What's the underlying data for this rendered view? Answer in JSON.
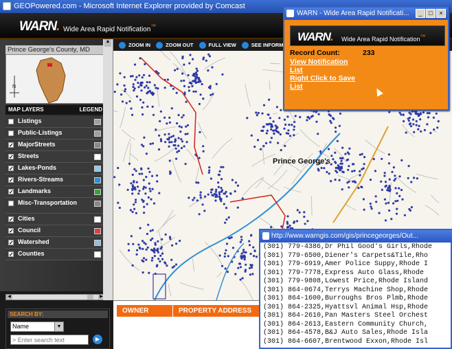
{
  "main_window": {
    "title": "GEOPowered.com - Microsoft Internet Explorer provided by Comcast"
  },
  "header": {
    "brand": "WARN",
    "tagline": "Wide Area Rapid Notification",
    "trademark": "™"
  },
  "left_panel": {
    "county_label": "Prince George's County, MD",
    "compass_letter": "N",
    "layers_heading": "MAP LAYERS",
    "legend_heading": "LEGEND",
    "layers": [
      {
        "label": "Listings",
        "checked": false,
        "swatch": "#9aa0a8"
      },
      {
        "label": "Public-Listings",
        "checked": false,
        "swatch": "#9aa0a8"
      },
      {
        "label": "MajorStreets",
        "checked": true,
        "swatch": "#888888"
      },
      {
        "label": "Streets",
        "checked": true,
        "swatch": "#ffffff"
      },
      {
        "label": "Lakes-Ponds",
        "checked": true,
        "swatch": "#8fc9ee"
      },
      {
        "label": "Rivers-Streams",
        "checked": true,
        "swatch": "#2f8fd8"
      },
      {
        "label": "Landmarks",
        "checked": true,
        "swatch": "#3aa33a"
      },
      {
        "label": "Misc-Transportation",
        "checked": false,
        "swatch": "#888888"
      },
      {
        "label": "Cities",
        "checked": true,
        "swatch": "#ffffff"
      },
      {
        "label": "Council",
        "checked": true,
        "swatch": "#e04040"
      },
      {
        "label": "Watershed",
        "checked": true,
        "swatch": "#8fc0e0"
      },
      {
        "label": "Counties",
        "checked": true,
        "swatch": "#ffffff"
      }
    ]
  },
  "toolbar": {
    "zoom_in": "ZOOM IN",
    "zoom_out": "ZOOM OUT",
    "full_view": "FULL VIEW",
    "see_info": "SEE INFORMA"
  },
  "map": {
    "place_label": "Prince George's"
  },
  "search": {
    "heading": "SEARCH BY:",
    "field_value": "Name",
    "input_placeholder": "> Enter search text"
  },
  "results": {
    "columns": [
      "OWNER",
      "PROPERTY ADDRESS"
    ]
  },
  "popup": {
    "title": "WARN - Wide Area Rapid Notificati...",
    "record_label": "Record Count:",
    "record_value": "233",
    "links": [
      "View Notification",
      "List",
      "Right Click to Save",
      "List"
    ]
  },
  "list_popup": {
    "title": "http://www.warngis.com/gis/princegeorges/Out...",
    "lines": [
      "(301) 779-4386,Dr Phil Good's Girls,Rhode",
      "(301) 779-6500,Diener's Carpets&Tile,Rho",
      "(301) 779-6919,Amer Police Suppy,Rhode I",
      "(301) 779-7778,Express Auto Glass,Rhode",
      "(301) 779-9808,Lowest Price,Rhode Island",
      "(301) 864-0674,Terrys Machine Shop,Rhode",
      "(301) 864-1600,Burroughs Bros Plmb,Rhode",
      "(301) 864-2325,Hyattsvl Animal Hsp,Rhode",
      "(301) 864-2610,Pan Masters Steel Orchest",
      "(301) 864-2613,Eastern Community Church,",
      "(301) 864-4578,B&J Auto Sales,Rhode Isla",
      "(301) 864-6607,Brentwood Exxon,Rhode Isl"
    ]
  },
  "colors": {
    "accent_orange": "#f48a16",
    "title_blue": "#2b57c2",
    "point_blue": "#2e3aa8"
  }
}
